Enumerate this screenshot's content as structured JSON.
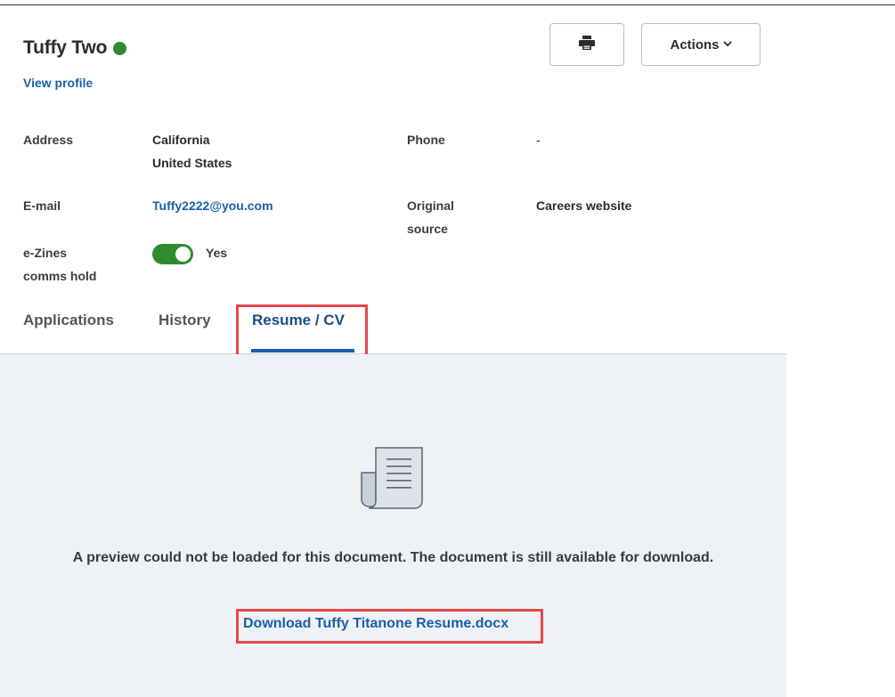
{
  "profile": {
    "name": "Tuffy Two",
    "view_profile": "View profile",
    "status_color": "#2e8b2e"
  },
  "toolbar": {
    "print_icon": "printer-icon",
    "actions_label": "Actions"
  },
  "details": {
    "address_label": "Address",
    "address_line1": "California",
    "address_line2": "United States",
    "phone_label": "Phone",
    "phone_value": "-",
    "email_label": "E-mail",
    "email_value": "Tuffy2222@you.com",
    "source_label_1": "Original",
    "source_label_2": "source",
    "source_value": "Careers website",
    "ezines_label_1": "e-Zines",
    "ezines_label_2": "comms hold",
    "ezines_value": "Yes",
    "ezines_on": true
  },
  "tabs": [
    {
      "label": "Applications"
    },
    {
      "label": "History"
    },
    {
      "label": "Resume / CV",
      "active": true
    }
  ],
  "preview": {
    "icon": "document-icon",
    "message": "A preview could not be loaded for this document. The document is still available for download.",
    "download_label": "Download Tuffy Titanone Resume.docx"
  },
  "colors": {
    "accent": "#1a5fad",
    "highlight": "#e5484d",
    "toggle_on": "#2e8b2e",
    "preview_bg": "#eef2f5"
  }
}
